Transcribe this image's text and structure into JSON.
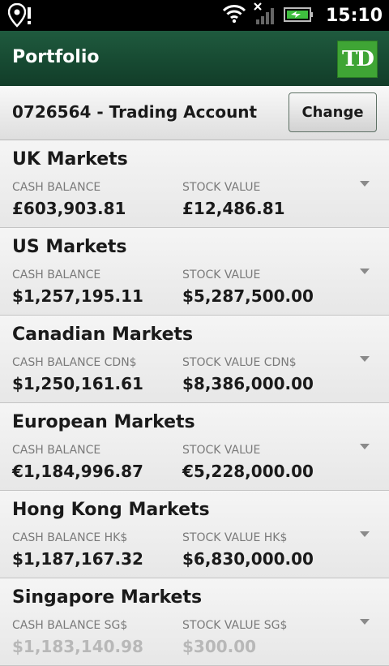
{
  "status_bar": {
    "time": "15:10",
    "icons": [
      "location-pin-icon",
      "notification-alert-icon",
      "wifi-icon",
      "signal-icon",
      "battery-charging-icon"
    ]
  },
  "header": {
    "title": "Portfolio",
    "logo_text": "TD",
    "colors": {
      "header_green": "#174a32",
      "logo_green": "#3fa535"
    }
  },
  "account": {
    "title": "0726564 - Trading Account",
    "change_label": "Change"
  },
  "markets": [
    {
      "name": "UK Markets",
      "cash_label": "CASH BALANCE",
      "cash_value": "£603,903.81",
      "stock_label": "STOCK VALUE",
      "stock_value": "£12,486.81"
    },
    {
      "name": "US Markets",
      "cash_label": "CASH BALANCE",
      "cash_value": "$1,257,195.11",
      "stock_label": "STOCK VALUE",
      "stock_value": "$5,287,500.00"
    },
    {
      "name": "Canadian Markets",
      "cash_label": "CASH BALANCE CDN$",
      "cash_value": "$1,250,161.61",
      "stock_label": "STOCK VALUE CDN$",
      "stock_value": "$8,386,000.00"
    },
    {
      "name": "European Markets",
      "cash_label": "CASH BALANCE",
      "cash_value": "€1,184,996.87",
      "stock_label": "STOCK VALUE",
      "stock_value": "€5,228,000.00"
    },
    {
      "name": "Hong Kong Markets",
      "cash_label": "CASH BALANCE HK$",
      "cash_value": "$1,187,167.32",
      "stock_label": "STOCK VALUE HK$",
      "stock_value": "$6,830,000.00"
    },
    {
      "name": "Singapore Markets",
      "cash_label": "CASH BALANCE SG$",
      "cash_value": "$1,183,140.98",
      "stock_label": "STOCK VALUE SG$",
      "stock_value": "$300.00"
    }
  ]
}
